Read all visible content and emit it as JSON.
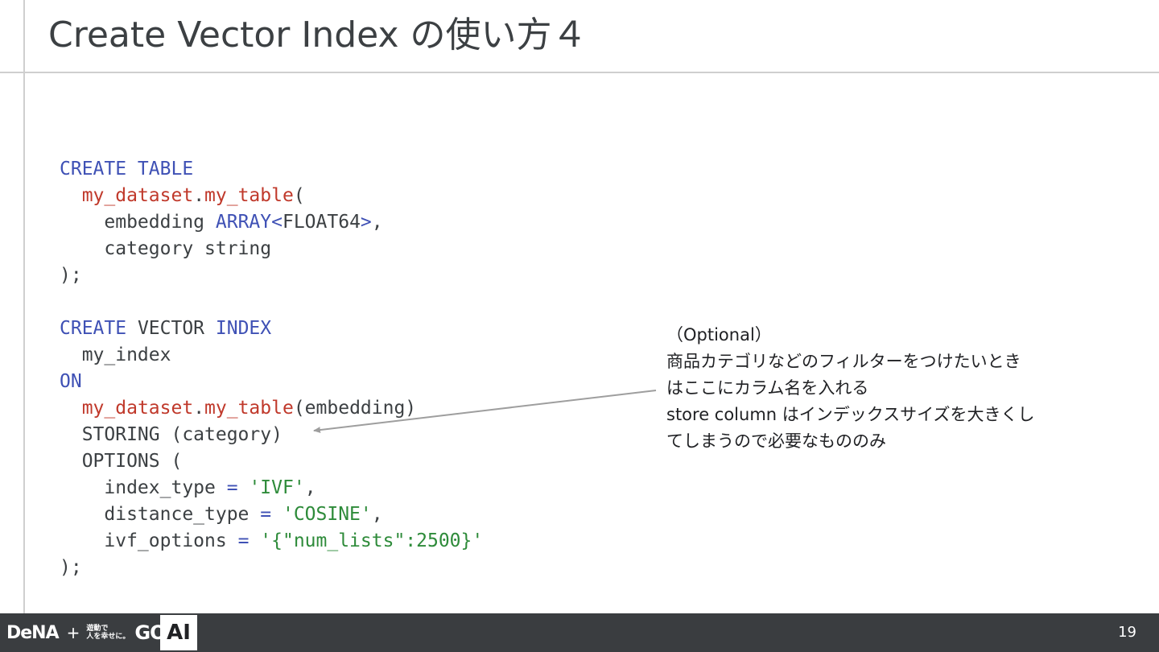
{
  "slide": {
    "title": "Create Vector Index の使い方４",
    "page_number": "19"
  },
  "code": {
    "lines": [
      [
        {
          "t": "CREATE TABLE",
          "c": "kw"
        }
      ],
      [
        {
          "t": "  ",
          "c": "pl"
        },
        {
          "t": "my_dataset",
          "c": "tb"
        },
        {
          "t": ".",
          "c": "pl"
        },
        {
          "t": "my_table",
          "c": "tb"
        },
        {
          "t": "(",
          "c": "pl"
        }
      ],
      [
        {
          "t": "    embedding ",
          "c": "pl"
        },
        {
          "t": "ARRAY",
          "c": "kw"
        },
        {
          "t": "<",
          "c": "kw"
        },
        {
          "t": "FLOAT64",
          "c": "pl"
        },
        {
          "t": ">",
          "c": "kw"
        },
        {
          "t": ",",
          "c": "pl"
        }
      ],
      [
        {
          "t": "    category string",
          "c": "pl"
        }
      ],
      [
        {
          "t": ");",
          "c": "pl"
        }
      ],
      [
        {
          "t": "",
          "c": "pl"
        }
      ],
      [
        {
          "t": "CREATE",
          "c": "kw"
        },
        {
          "t": " VECTOR ",
          "c": "pl"
        },
        {
          "t": "INDEX",
          "c": "kw"
        }
      ],
      [
        {
          "t": "  my_index",
          "c": "pl"
        }
      ],
      [
        {
          "t": "ON",
          "c": "kw"
        }
      ],
      [
        {
          "t": "  ",
          "c": "pl"
        },
        {
          "t": "my_dataset",
          "c": "tb"
        },
        {
          "t": ".",
          "c": "pl"
        },
        {
          "t": "my_table",
          "c": "tb"
        },
        {
          "t": "(embedding)",
          "c": "pl"
        }
      ],
      [
        {
          "t": "  STORING (category)",
          "c": "pl"
        }
      ],
      [
        {
          "t": "  OPTIONS (",
          "c": "pl"
        }
      ],
      [
        {
          "t": "    index_type ",
          "c": "pl"
        },
        {
          "t": "=",
          "c": "kw"
        },
        {
          "t": " ",
          "c": "pl"
        },
        {
          "t": "'IVF'",
          "c": "st"
        },
        {
          "t": ",",
          "c": "pl"
        }
      ],
      [
        {
          "t": "    distance_type ",
          "c": "pl"
        },
        {
          "t": "=",
          "c": "kw"
        },
        {
          "t": " ",
          "c": "pl"
        },
        {
          "t": "'COSINE'",
          "c": "st"
        },
        {
          "t": ",",
          "c": "pl"
        }
      ],
      [
        {
          "t": "    ivf_options ",
          "c": "pl"
        },
        {
          "t": "=",
          "c": "kw"
        },
        {
          "t": " ",
          "c": "pl"
        },
        {
          "t": "'{\"num_lists\":2500}'",
          "c": "st"
        }
      ],
      [
        {
          "t": ");",
          "c": "pl"
        }
      ]
    ]
  },
  "note": {
    "lines": [
      "（Optional）",
      "商品カテゴリなどのフィルターをつけたいとき",
      "はここにカラム名を入れる",
      "store column はインデックスサイズを大きくし",
      "てしまうので必要なもののみ"
    ]
  },
  "footer": {
    "brand": "DeNA",
    "plus": "+",
    "partner_line1": "遊動で",
    "partner_line2": "人を幸せに。",
    "partner_mark": "GO",
    "ai_label": "AI"
  },
  "colors": {
    "keyword": "#3f51b5",
    "table": "#c0392b",
    "string": "#2e8b3a",
    "footer_bg": "#3a3d40"
  }
}
